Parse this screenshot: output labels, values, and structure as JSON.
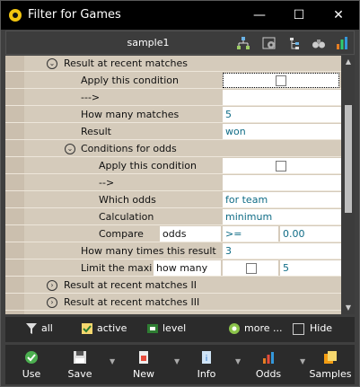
{
  "window": {
    "title": "Filter for Games",
    "min": "—",
    "max": "☐",
    "close": "✕"
  },
  "header": {
    "profile": "sample1"
  },
  "grid": {
    "section1": "Result at recent matches",
    "apply1": "Apply this condition",
    "arrow1": "--->",
    "howmany_label": "How many matches",
    "howmany_value": "5",
    "result_label": "Result",
    "result_value": "won",
    "odds_section": "Conditions for odds",
    "apply2": "Apply this condition",
    "arrow2": "-->",
    "which_label": "Which odds",
    "which_value": "for team",
    "calc_label": "Calculation",
    "calc_value": "minimum",
    "compare_label": "Compare",
    "compare_sub": "odds",
    "compare_op": ">=",
    "compare_value": "0.00",
    "times_label": "How many times this result",
    "times_value": "3",
    "limit_label": "Limit the maximu",
    "limit_sub": "how many",
    "limit_value": "5",
    "section2": "Result at recent matches II",
    "section3": "Result at recent matches III"
  },
  "bottom1": {
    "all": "all",
    "active": "active",
    "level": "level",
    "more": "more ...",
    "hide": "Hide"
  },
  "bottom2": {
    "use": "Use",
    "save": "Save",
    "new": "New",
    "info": "Info",
    "odds": "Odds",
    "samples": "Samples"
  }
}
